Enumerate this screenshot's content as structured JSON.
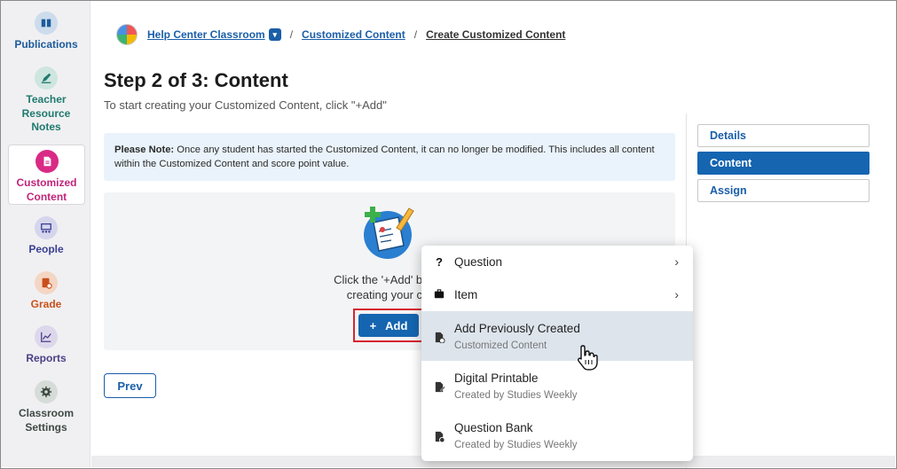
{
  "sidebar": {
    "items": [
      {
        "label": "Publications",
        "icon": "book-icon"
      },
      {
        "label": "Teacher Resource Notes",
        "icon": "pen-icon"
      },
      {
        "label": "Customized Content",
        "icon": "document-icon"
      },
      {
        "label": "People",
        "icon": "people-icon"
      },
      {
        "label": "Grade",
        "icon": "grade-icon"
      },
      {
        "label": "Reports",
        "icon": "chart-icon"
      },
      {
        "label": "Classroom Settings",
        "icon": "gear-icon"
      }
    ]
  },
  "breadcrumb": {
    "classroom": "Help Center Classroom",
    "sep": "/",
    "section": "Customized Content",
    "current": "Create Customized Content"
  },
  "page": {
    "title": "Step 2 of 3: Content",
    "subtitle": "To start creating your Customized Content, click \"+Add\""
  },
  "note": {
    "label": "Please Note:",
    "text": " Once any student has started the Customized Content, it can no longer be modified. This includes all content within the Customized Content and score point value."
  },
  "empty_state": {
    "line1": "Click the '+Add' butto",
    "line2": "creating your co"
  },
  "add_button": {
    "plus": "+",
    "label": "Add"
  },
  "prev_button": {
    "label": "Prev"
  },
  "steps": [
    {
      "label": "Details",
      "active": false
    },
    {
      "label": "Content",
      "active": true
    },
    {
      "label": "Assign",
      "active": false
    }
  ],
  "menu": {
    "items": [
      {
        "label": "Question",
        "sub": "",
        "icon": "question-icon",
        "submenu": true
      },
      {
        "label": "Item",
        "sub": "",
        "icon": "briefcase-icon",
        "submenu": true
      },
      {
        "label": "Add Previously Created",
        "sub": "Customized Content",
        "icon": "file-add-icon",
        "submenu": false
      },
      {
        "label": "Digital Printable",
        "sub": "Created by Studies Weekly",
        "icon": "file-edit-icon",
        "submenu": false
      },
      {
        "label": "Question Bank",
        "sub": "Created by Studies Weekly",
        "icon": "file-question-icon",
        "submenu": false
      }
    ]
  },
  "colors": {
    "primary": "#1565b0",
    "accent_pink": "#d92a86",
    "highlight_border": "#d8242e"
  }
}
